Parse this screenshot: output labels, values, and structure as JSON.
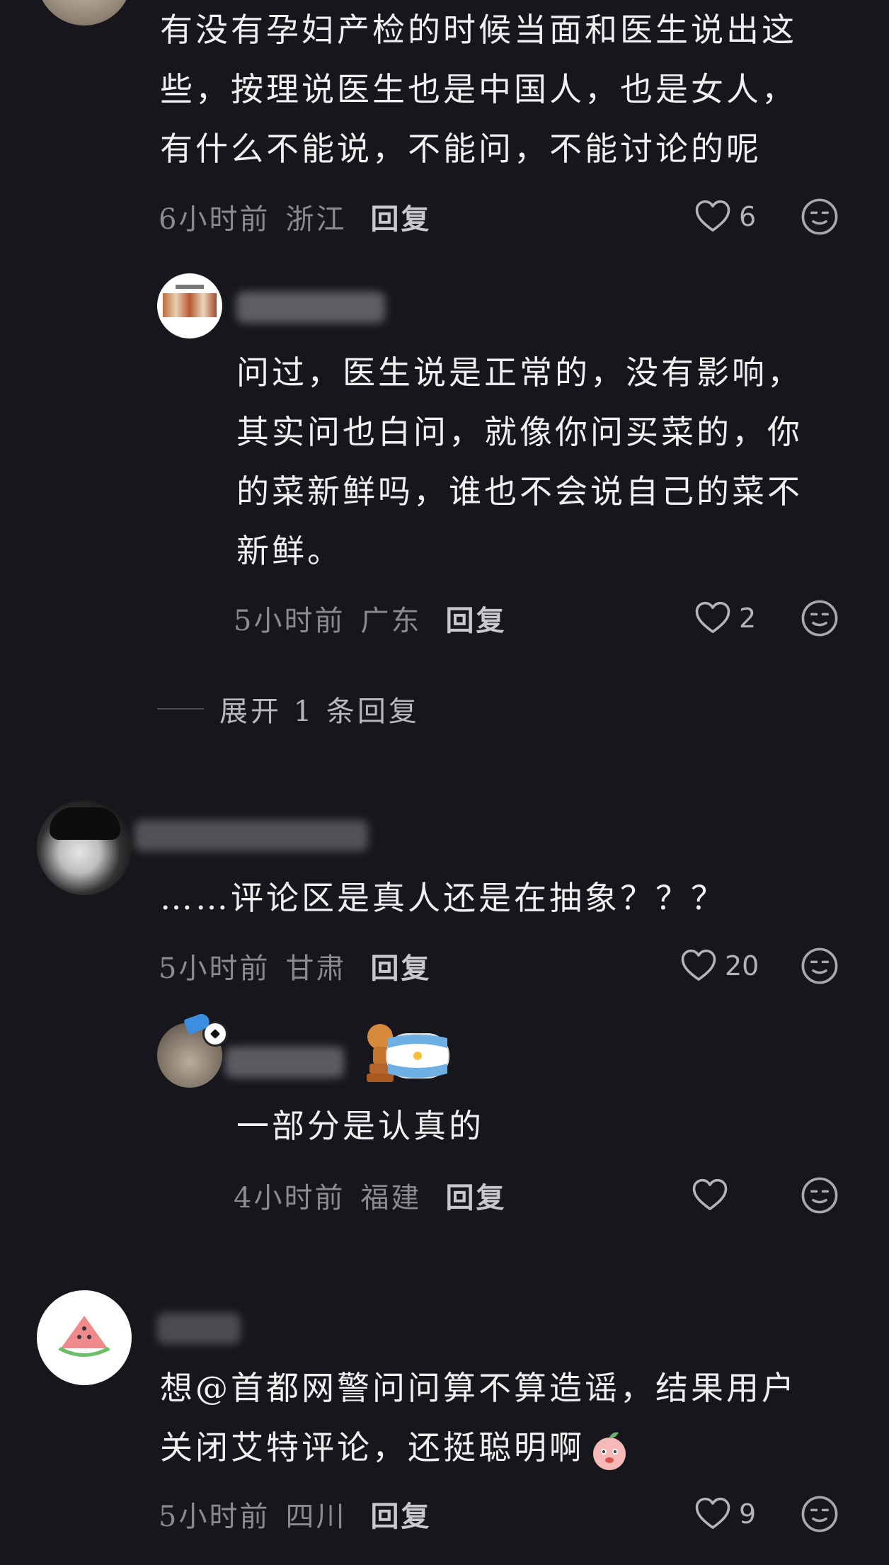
{
  "comments": [
    {
      "text": "有没有孕妇产检的时候当面和医生说出这\n些，按理说医生也是中国人，也是女人，\n有什么不能说，不能问，不能讨论的呢",
      "time": "6小时前",
      "location": "浙江",
      "reply_label": "回复",
      "likes": "6",
      "replies": [
        {
          "text": "问过，医生说是正常的，没有影响，\n其实问也白问，就像你问买菜的，你\n的菜新鲜吗，谁也不会说自己的菜不\n新鲜。",
          "time": "5小时前",
          "location": "广东",
          "reply_label": "回复",
          "likes": "2"
        }
      ],
      "expand_label": "展开 1 条回复"
    },
    {
      "text": "……评论区是真人还是在抽象？？？",
      "time": "5小时前",
      "location": "甘肃",
      "reply_label": "回复",
      "likes": "20",
      "replies": [
        {
          "text": "一部分是认真的",
          "time": "4小时前",
          "location": "福建",
          "reply_label": "回复",
          "likes": ""
        }
      ]
    },
    {
      "text": "想@首都网警问问算不算造谣，结果用户\n关闭艾特评论，还挺聪明啊",
      "time": "5小时前",
      "location": "四川",
      "reply_label": "回复",
      "likes": "9"
    }
  ],
  "icons": {
    "like": "heart-outline-icon",
    "emoji": "neutral-face-icon"
  },
  "colors": {
    "background": "#17161d",
    "text": "#f0f0f0",
    "meta": "#8b8a90"
  }
}
